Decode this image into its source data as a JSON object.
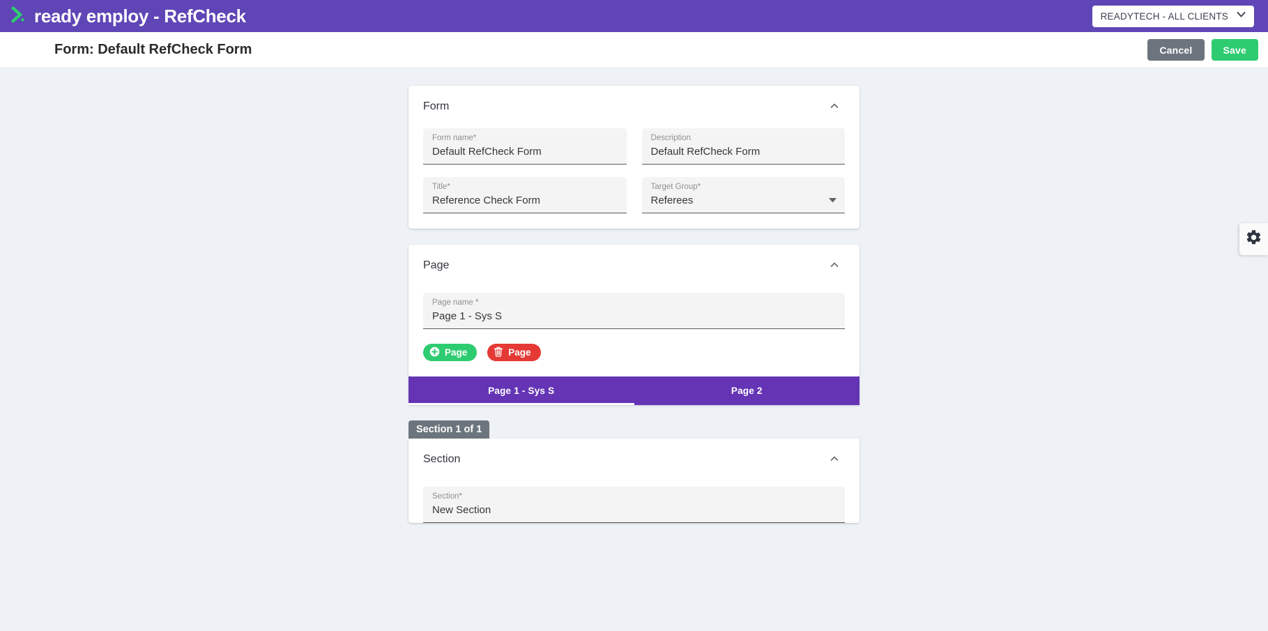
{
  "topbar": {
    "brand_text": "ready employ - RefCheck",
    "brand_mark_icon": "chevron-right-logo-icon",
    "client_selector": {
      "value": "READYTECH - ALL CLIENTS",
      "chevron_icon": "chevron-down-icon"
    }
  },
  "subheader": {
    "title": "Form: Default RefCheck Form",
    "cancel_label": "Cancel",
    "save_label": "Save"
  },
  "form_card": {
    "title": "Form",
    "collapse_icon": "chevron-up-icon",
    "fields": [
      {
        "label": "Form name*",
        "value": "Default RefCheck Form",
        "type": "text"
      },
      {
        "label": "Description",
        "value": "Default RefCheck Form",
        "type": "text"
      },
      {
        "label": "Title*",
        "value": "Reference Check Form",
        "type": "text"
      },
      {
        "label": "Target Group*",
        "value": "Referees",
        "type": "select",
        "arrow_icon": "dropdown-arrow-icon"
      }
    ]
  },
  "page_card": {
    "title": "Page",
    "collapse_icon": "chevron-up-icon",
    "page_name_label": "Page name *",
    "page_name_value": "Page 1 - Sys S",
    "add_page_label": "Page",
    "add_page_icon": "plus-circle-icon",
    "delete_page_label": "Page",
    "delete_page_icon": "trash-icon"
  },
  "tabs": [
    {
      "label": "Page 1 - Sys S",
      "active": true
    },
    {
      "label": "Page 2",
      "active": false
    }
  ],
  "section": {
    "badge": "Section 1 of 1",
    "title": "Section",
    "collapse_icon": "chevron-up-icon",
    "field_label": "Section*",
    "field_value": "New Section"
  },
  "side_panel": {
    "gear_icon": "gear-icon"
  },
  "colors": {
    "brand_purple": "#5f45b5",
    "tab_purple": "#6434b5",
    "accent_green": "#2ecc71",
    "danger_red": "#e53935",
    "neutral_gray": "#6c757d",
    "page_background": "#eef1f6",
    "field_fill": "#f4f4f4"
  }
}
